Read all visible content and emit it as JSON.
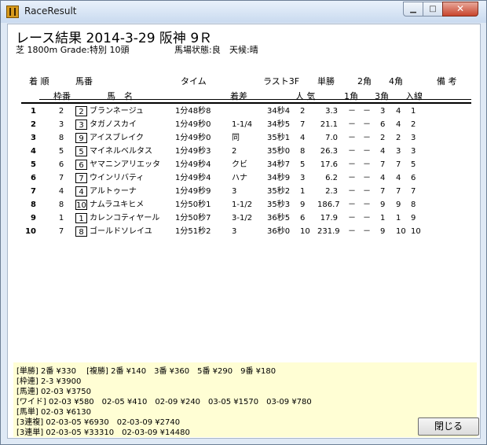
{
  "window": {
    "title": "RaceResult"
  },
  "heading": "レース結果 2014-3-29 阪神 9Ｒ",
  "race_info": {
    "conditions": "芝 1800m Grade:特別 10頭",
    "track_condition": "馬場状態:良",
    "weather": "天候:晴"
  },
  "columns": {
    "rank": "着 順",
    "gate": "枠番",
    "horse_num": "馬番",
    "horse_name": "馬　名",
    "time": "タイム",
    "margin": "着差",
    "last3f": "ラスト3F",
    "popularity": "人 気",
    "win_odds": "単勝",
    "corner1": "1角",
    "corner2": "2角",
    "corner3": "3角",
    "corner4": "4角",
    "finish_line": "入線",
    "remarks": "備 考"
  },
  "rows": [
    {
      "rank": "1",
      "gate": "2",
      "num": "2",
      "name": "ブランネージュ",
      "time": "1分48秒8",
      "margin": "",
      "last3f": "34秒4",
      "pop": "2",
      "odds": "3.3",
      "c1": "－",
      "c2": "－",
      "c3": "3",
      "c4": "4",
      "fin": "1"
    },
    {
      "rank": "2",
      "gate": "3",
      "num": "3",
      "name": "タガノスカイ",
      "time": "1分49秒0",
      "margin": "1-1/4",
      "last3f": "34秒5",
      "pop": "7",
      "odds": "21.1",
      "c1": "－",
      "c2": "－",
      "c3": "6",
      "c4": "4",
      "fin": "2"
    },
    {
      "rank": "3",
      "gate": "8",
      "num": "9",
      "name": "アイスブレイク",
      "time": "1分49秒0",
      "margin": "同",
      "last3f": "35秒1",
      "pop": "4",
      "odds": "7.0",
      "c1": "－",
      "c2": "－",
      "c3": "2",
      "c4": "2",
      "fin": "3"
    },
    {
      "rank": "4",
      "gate": "5",
      "num": "5",
      "name": "マイネルベルタス",
      "time": "1分49秒3",
      "margin": "2",
      "last3f": "35秒0",
      "pop": "8",
      "odds": "26.3",
      "c1": "－",
      "c2": "－",
      "c3": "4",
      "c4": "3",
      "fin": "3"
    },
    {
      "rank": "5",
      "gate": "6",
      "num": "6",
      "name": "ヤマニンアリエッタ",
      "time": "1分49秒4",
      "margin": "クビ",
      "last3f": "34秒7",
      "pop": "5",
      "odds": "17.6",
      "c1": "－",
      "c2": "－",
      "c3": "7",
      "c4": "7",
      "fin": "5"
    },
    {
      "rank": "6",
      "gate": "7",
      "num": "7",
      "name": "ウインリバティ",
      "time": "1分49秒4",
      "margin": "ハナ",
      "last3f": "34秒9",
      "pop": "3",
      "odds": "6.2",
      "c1": "－",
      "c2": "－",
      "c3": "4",
      "c4": "4",
      "fin": "6"
    },
    {
      "rank": "7",
      "gate": "4",
      "num": "4",
      "name": "アルトゥーナ",
      "time": "1分49秒9",
      "margin": "3",
      "last3f": "35秒2",
      "pop": "1",
      "odds": "2.3",
      "c1": "－",
      "c2": "－",
      "c3": "7",
      "c4": "7",
      "fin": "7"
    },
    {
      "rank": "8",
      "gate": "8",
      "num": "10",
      "name": "ナムラユキヒメ",
      "time": "1分50秒1",
      "margin": "1-1/2",
      "last3f": "35秒3",
      "pop": "9",
      "odds": "186.7",
      "c1": "－",
      "c2": "－",
      "c3": "9",
      "c4": "9",
      "fin": "8"
    },
    {
      "rank": "9",
      "gate": "1",
      "num": "1",
      "name": "カレンコティヤール",
      "time": "1分50秒7",
      "margin": "3-1/2",
      "last3f": "36秒5",
      "pop": "6",
      "odds": "17.9",
      "c1": "－",
      "c2": "－",
      "c3": "1",
      "c4": "1",
      "fin": "9"
    },
    {
      "rank": "10",
      "gate": "7",
      "num": "8",
      "name": "ゴールドソレイユ",
      "time": "1分51秒2",
      "margin": "3",
      "last3f": "36秒0",
      "pop": "10",
      "odds": "231.9",
      "c1": "－",
      "c2": "－",
      "c3": "9",
      "c4": "10",
      "fin": "10"
    }
  ],
  "payouts": [
    "[単勝] 2番 ¥330　 [複勝] 2番 ¥140　3番 ¥360　5番 ¥290　9番 ¥180",
    "[枠連] 2-3 ¥3900",
    "[馬連] 02-03 ¥3750",
    "[ワイド] 02-03 ¥580　02-05 ¥410　02-09 ¥240　03-05 ¥1570　03-09 ¥780",
    "[馬単] 02-03 ¥6130",
    "[3連複] 02-03-05 ¥6930　02-03-09 ¥2740",
    "[3連単] 02-03-05 ¥33310　02-03-09 ¥14480"
  ],
  "close_button": "閉じる"
}
